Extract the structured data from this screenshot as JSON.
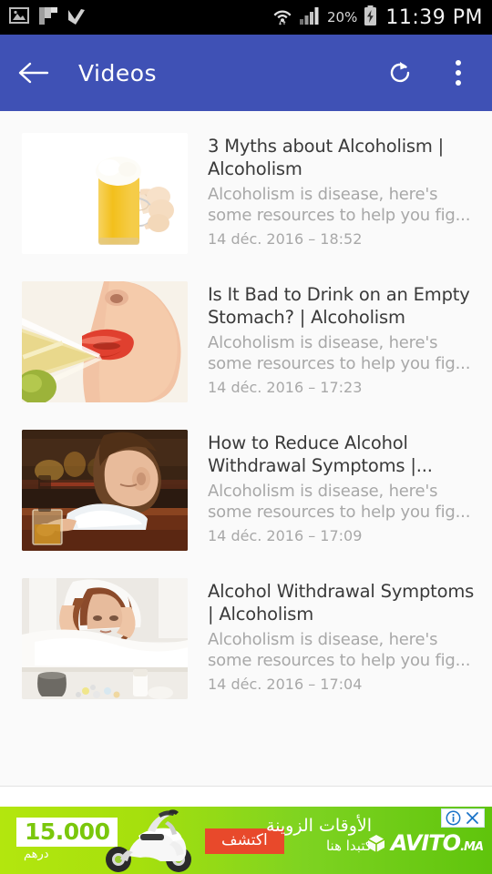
{
  "status_bar": {
    "left_icons": [
      "image-icon",
      "flipboard-icon",
      "checkmark-icon"
    ],
    "wifi_icon": "wifi-icon",
    "signal_icon": "cellular-signal-icon",
    "battery_percent": "20%",
    "battery_icon": "battery-charging-icon",
    "clock": "11:39 PM"
  },
  "appbar": {
    "back_icon": "back-arrow-icon",
    "title": "Videos",
    "refresh_icon": "refresh-icon",
    "overflow_icon": "overflow-menu-icon",
    "background_color": "#3f51b5"
  },
  "videos": [
    {
      "title": "3 Myths about Alcoholism | Alcoholism",
      "description": "Alcoholism is disease, here's some resources to help you fig...",
      "date": "14 déc. 2016 – 18:52",
      "thumbnail": "beer-mug-in-hand-thumbnail"
    },
    {
      "title": "Is It Bad to Drink on an Empty Stomach? | Alcoholism",
      "description": "Alcoholism is disease, here's some resources to help you fig...",
      "date": "14 déc. 2016 – 17:23",
      "thumbnail": "woman-drinking-martini-thumbnail"
    },
    {
      "title": "How to Reduce Alcohol Withdrawal Symptoms |...",
      "description": "Alcoholism is disease, here's some resources to help you fig...",
      "date": "14 déc. 2016 – 17:09",
      "thumbnail": "man-asleep-at-bar-thumbnail"
    },
    {
      "title": "Alcohol Withdrawal Symptoms | Alcoholism",
      "description": "Alcoholism is disease, here's some resources to help you fig...",
      "date": "14 déc. 2016 – 17:04",
      "thumbnail": "woman-hungover-in-bed-thumbnail"
    }
  ],
  "ad": {
    "price": "15.000",
    "currency": "درهم",
    "cta_label": "اكتشف",
    "headline": "الأوقات الزوينة",
    "subline": "كتبدا هنا",
    "brand": "AVITO",
    "brand_tld": ".MA",
    "info_icon": "adchoices-info-icon",
    "close_icon": "ad-close-icon",
    "background_color": "#7ed321"
  }
}
